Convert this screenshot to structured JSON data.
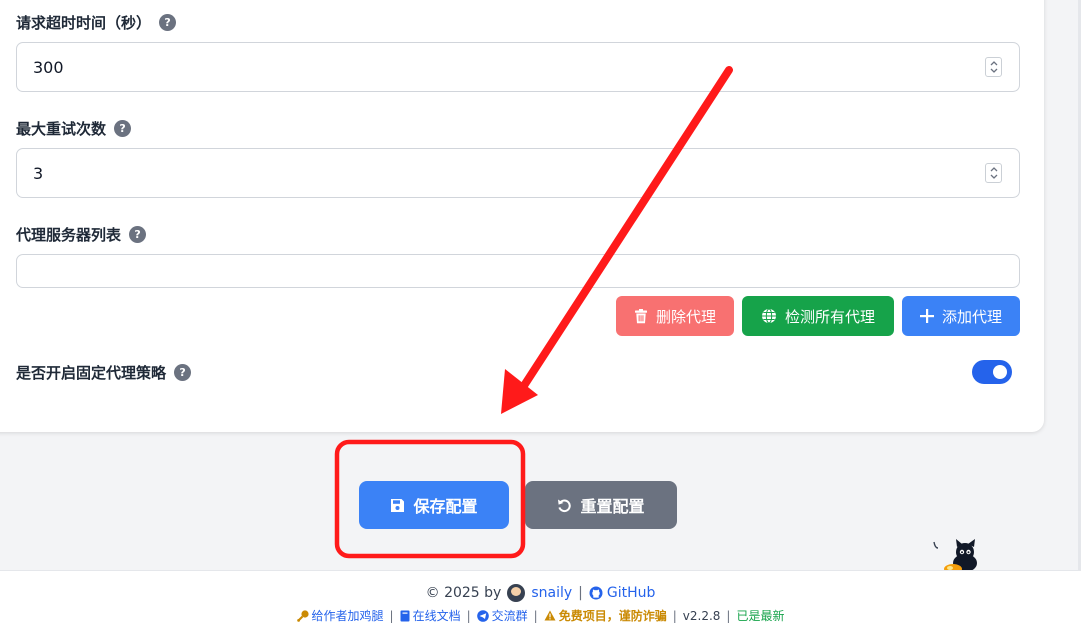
{
  "form": {
    "timeout_label": "请求超时时间（秒）",
    "timeout_value": "300",
    "retry_label": "最大重试次数",
    "retry_value": "3",
    "proxy_label": "代理服务器列表",
    "proxy_value": "",
    "strategy_label": "是否开启固定代理策略",
    "help_glyph": "?",
    "strategy_enabled": true
  },
  "proxy_buttons": {
    "delete": "删除代理",
    "check": "检测所有代理",
    "add": "添加代理"
  },
  "actions": {
    "save": "保存配置",
    "reset": "重置配置"
  },
  "footer": {
    "copyright": "© 2025 by",
    "author": "snaily",
    "github": "GitHub",
    "sep": "|",
    "donate": "给作者加鸡腿",
    "docs": "在线文档",
    "group": "交流群",
    "warning": "免费项目，谨防诈骗",
    "version": "v2.2.8",
    "status": "已是最新"
  },
  "colors": {
    "primary": "#3b82f6",
    "danger": "#f87171",
    "success": "#16a34a",
    "secondary": "#6b7280",
    "annotation": "#ff1a1a"
  }
}
